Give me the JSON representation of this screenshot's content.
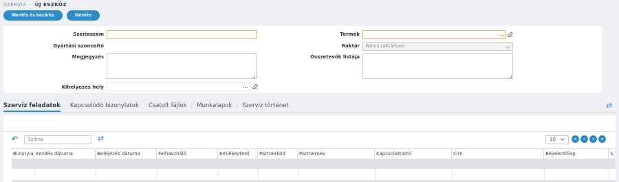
{
  "breadcrumb": {
    "parent": "Szerviz",
    "separator": "-",
    "current": "Új eszköz"
  },
  "toolbar": {
    "save_close_label": "Mentés és bezárás",
    "save_label": "Mentés"
  },
  "form": {
    "serial_label": "Szériaszám",
    "serial_value": "",
    "manufacturer_id_label": "Gyártási azonosító",
    "manufacturer_id_value": "",
    "note_label": "Megjegyzés",
    "note_value": "",
    "placement_label": "Kihelyezés hely",
    "placement_value": "",
    "product_label": "Termék",
    "product_value": "",
    "warehouse_label": "Raktár",
    "warehouse_value": "Nincs raktárban",
    "components_label": "Összetevők listája",
    "components_value": "",
    "lookup_dots": "..."
  },
  "tabs": [
    {
      "label": "Szerviz feladatok",
      "active": true
    },
    {
      "label": "Kapcsolódó bizonylatok",
      "active": false
    },
    {
      "label": "Csatolt fájlok",
      "active": false
    },
    {
      "label": "Munkalapok",
      "active": false
    },
    {
      "label": "Szerviz történet",
      "active": false
    }
  ],
  "grid": {
    "filter_placeholder": "Szűrés",
    "page_size": "10",
    "columns": [
      "Bizonylat",
      "Kezdés dátuma",
      "Befejezés dátuma",
      "Felhasználó",
      "Emlékeztető",
      "Partnerkód",
      "Partnernév",
      "Kapcsolattartó",
      "Cím",
      "Bejelentőlap",
      "S"
    ],
    "rows": []
  },
  "colors": {
    "accent": "#2c8bc9",
    "focus_border": "#f0b24a",
    "background": "#eef0f3"
  },
  "icons": [
    "undo-icon",
    "swap-icon",
    "edit-icon",
    "first-page-icon",
    "prev-page-icon",
    "next-page-icon",
    "last-page-icon"
  ]
}
